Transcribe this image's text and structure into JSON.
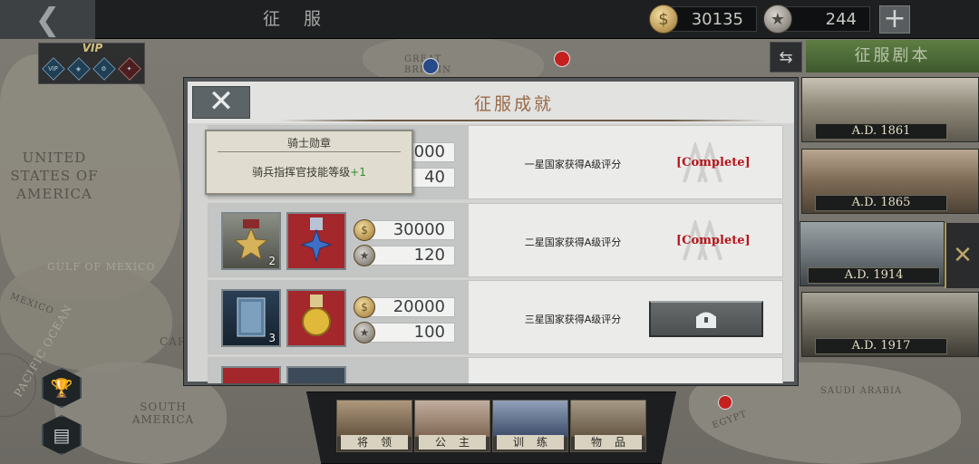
{
  "topbar": {
    "back_icon": "chevron-left-icon",
    "title": "征服",
    "gold_amount": "30135",
    "medal_amount": "244",
    "gold_icon": "gold-coin-icon",
    "medal_icon": "silver-medal-icon",
    "plus_label": "+"
  },
  "vip": {
    "label": "VIP",
    "badges": [
      "VIP",
      "◈",
      "⚙",
      "✦"
    ]
  },
  "map": {
    "labels": {
      "usa": "UNITED STATES OF AMERICA",
      "gulf": "GULF OF MEXICO",
      "mexico": "MEXICO",
      "south_america": "SOUTH AMERICA",
      "saudi": "SAUDI ARABIA",
      "egypt": "EGYPT",
      "britain": "GREAT BRITAIN",
      "pacific": "PACIFIC OCEAN",
      "carib": "CAR"
    }
  },
  "side_buttons": {
    "trophy_icon": "trophy-icon",
    "document_icon": "document-icon"
  },
  "scenarios": {
    "title": "征服剧本",
    "swap_icon": "swap-arrows-icon",
    "items": [
      {
        "year": "A.D. 1861"
      },
      {
        "year": "A.D. 1865"
      },
      {
        "year": "A.D. 1914"
      },
      {
        "year": "A.D. 1917"
      }
    ],
    "selected_icon": "crossed-swords-icon"
  },
  "dialog": {
    "title": "征服成就",
    "close_icon": "close-icon",
    "rows": [
      {
        "gold": "30000",
        "medals": "40",
        "requirement": "一星国家获得A级评分",
        "status": "[Complete]",
        "gold_partial": "0000",
        "medals_partial": "40"
      },
      {
        "item1_count": "2",
        "gold": "30000",
        "medals": "120",
        "requirement": "二星国家获得A级评分",
        "status": "[Complete]"
      },
      {
        "item1_count": "3",
        "gold": "20000",
        "medals": "100",
        "requirement": "三星国家获得A级评分",
        "claim_icon": "treasure-chest-icon"
      }
    ]
  },
  "tooltip": {
    "title": "骑士勋章",
    "desc_prefix": "骑兵指挥官技能等级",
    "desc_bonus": "+1"
  },
  "bottom_tabs": [
    {
      "label": "将领"
    },
    {
      "label": "公主"
    },
    {
      "label": "训练"
    },
    {
      "label": "物品"
    }
  ],
  "colors": {
    "complete": "#b5151b",
    "title_accent": "#9a6a4a",
    "scenario_title_bg": "#4e6c38",
    "bonus_green": "#2e8d2e"
  }
}
